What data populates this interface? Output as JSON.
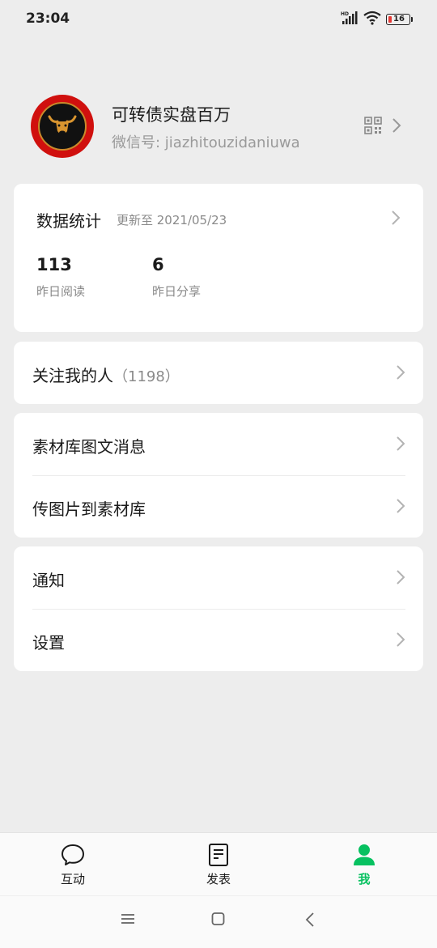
{
  "status_bar": {
    "time": "23:04",
    "network": "HD",
    "battery": "16"
  },
  "profile": {
    "name": "可转债实盘百万",
    "wechat_id": "微信号: jiazhitouzidaniuwa"
  },
  "stats": {
    "title": "数据统计",
    "updated": "更新至 2021/05/23",
    "items": [
      {
        "value": "113",
        "label": "昨日阅读"
      },
      {
        "value": "6",
        "label": "昨日分享"
      }
    ]
  },
  "followers": {
    "label": "关注我的人",
    "count": "（1198）"
  },
  "materials": {
    "items": [
      {
        "label": "素材库图文消息"
      },
      {
        "label": "传图片到素材库"
      }
    ]
  },
  "settings": {
    "items": [
      {
        "label": "通知"
      },
      {
        "label": "设置"
      }
    ]
  },
  "tabbar": {
    "tabs": [
      {
        "label": "互动",
        "icon": "chat-bubble-icon"
      },
      {
        "label": "发表",
        "icon": "document-icon"
      },
      {
        "label": "我",
        "icon": "person-icon"
      }
    ],
    "active_color": "#07c160"
  },
  "colors": {
    "background": "#EDEDED",
    "card": "#ffffff",
    "avatar_ring": "#d0100e",
    "battery_low": "#e53935"
  }
}
